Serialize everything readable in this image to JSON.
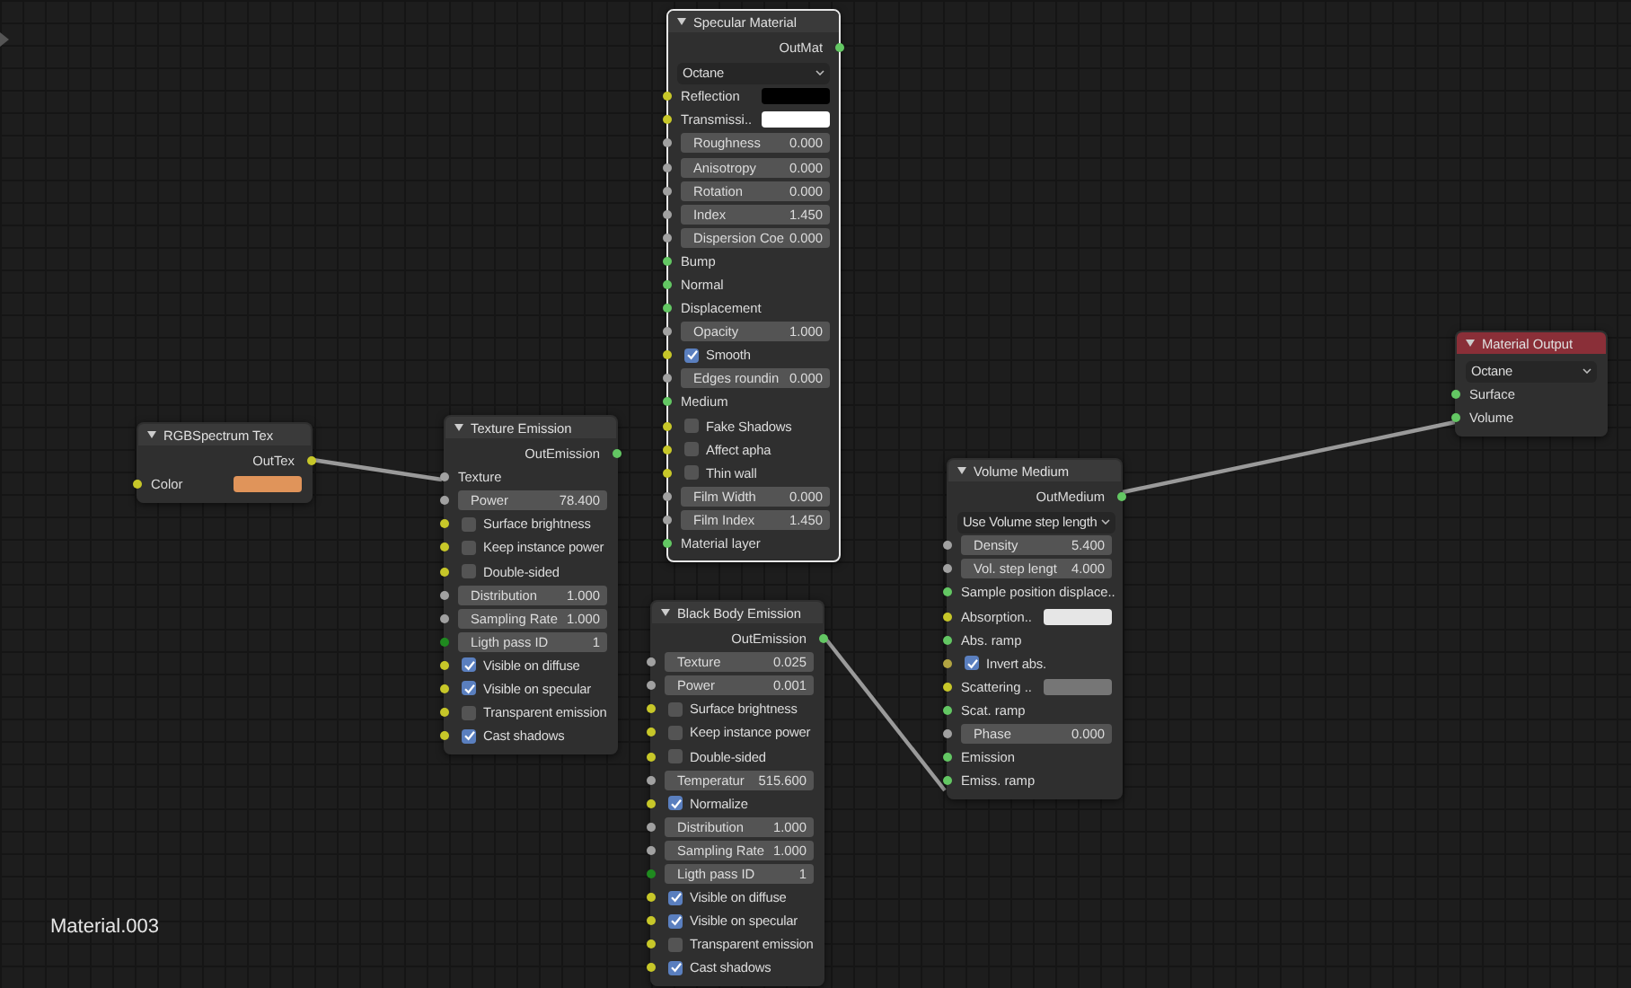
{
  "nodes": [
    {
      "title": "Specular Material",
      "selected": true,
      "color": "#3a3a3a",
      "rows": [
        {
          "kind": "output",
          "label": "OutMat",
          "color": "#63c763"
        },
        {
          "kind": "dropdown",
          "value": "Octane"
        },
        {
          "kind": "color",
          "label": "Reflection",
          "color": "#c7c729",
          "swatch": {
            "color": "#000000"
          }
        },
        {
          "kind": "color",
          "label": "Transmissi..",
          "color": "#c7c729",
          "swatch": {
            "color": "#ffffff"
          }
        },
        {
          "kind": "field",
          "label": "Roughness",
          "value": "0.000",
          "color": "#a1a1a1"
        },
        {
          "kind": "field",
          "label": "Anisotropy",
          "value": "0.000",
          "color": "#a1a1a1"
        },
        {
          "kind": "field",
          "label": "Rotation",
          "value": "0.000",
          "color": "#a1a1a1"
        },
        {
          "kind": "field",
          "label": "Index",
          "value": "1.450",
          "color": "#a1a1a1"
        },
        {
          "kind": "field",
          "label": "Dispersion Coe",
          "value": "0.000",
          "color": "#a1a1a1"
        },
        {
          "kind": "socket",
          "label": "Bump",
          "color": "#63c763"
        },
        {
          "kind": "socket",
          "label": "Normal",
          "color": "#63c763"
        },
        {
          "kind": "socket",
          "label": "Displacement",
          "color": "#63c763"
        },
        {
          "kind": "field",
          "label": "Opacity",
          "value": "1.000",
          "color": "#a1a1a1"
        },
        {
          "kind": "checkbox",
          "label": "Smooth",
          "checked": true,
          "color": "#c7c729"
        },
        {
          "kind": "field",
          "label": "Edges roundin",
          "value": "0.000",
          "color": "#a1a1a1"
        },
        {
          "kind": "socket",
          "label": "Medium",
          "color": "#63c763"
        },
        {
          "kind": "checkbox",
          "label": "Fake Shadows",
          "checked": false,
          "color": "#c7c729"
        },
        {
          "kind": "checkbox",
          "label": "Affect apha",
          "checked": false,
          "color": "#c7c729"
        },
        {
          "kind": "checkbox",
          "label": "Thin wall",
          "checked": false,
          "color": "#c7c729"
        },
        {
          "kind": "field",
          "label": "Film Width",
          "value": "0.000",
          "color": "#a1a1a1"
        },
        {
          "kind": "field",
          "label": "Film Index",
          "value": "1.450",
          "color": "#a1a1a1"
        },
        {
          "kind": "socket",
          "label": "Material layer",
          "color": "#63c763"
        }
      ]
    },
    {
      "title": "RGBSpectrum Tex",
      "selected": false,
      "color": "#3a3a3a",
      "rows": [
        {
          "kind": "output",
          "label": "OutTex",
          "color": "#c7c729"
        },
        {
          "kind": "color",
          "label": "Color",
          "color": "#c7c729",
          "swatch": {
            "color": "#e0945a"
          }
        }
      ]
    },
    {
      "title": "Texture Emission",
      "selected": false,
      "color": "#3a3a3a",
      "rows": [
        {
          "kind": "output",
          "label": "OutEmission",
          "color": "#63c763"
        },
        {
          "kind": "socket",
          "label": "Texture",
          "color": "#a1a1a1"
        },
        {
          "kind": "field",
          "label": "Power",
          "value": "78.400",
          "color": "#a1a1a1"
        },
        {
          "kind": "checkbox",
          "label": "Surface brightness",
          "checked": false,
          "color": "#c7c729"
        },
        {
          "kind": "checkbox",
          "label": "Keep instance power",
          "checked": false,
          "color": "#c7c729"
        },
        {
          "kind": "checkbox",
          "label": "Double-sided",
          "checked": false,
          "color": "#c7c729"
        },
        {
          "kind": "field",
          "label": "Distribution",
          "value": "1.000",
          "color": "#a1a1a1"
        },
        {
          "kind": "field",
          "label": "Sampling Rate",
          "value": "1.000",
          "color": "#a1a1a1"
        },
        {
          "kind": "field",
          "label": "Ligth pass ID",
          "value": "1",
          "color": "#1f8a1f"
        },
        {
          "kind": "checkbox",
          "label": "Visible on diffuse",
          "checked": true,
          "color": "#c7c729"
        },
        {
          "kind": "checkbox",
          "label": "Visible on specular",
          "checked": true,
          "color": "#c7c729"
        },
        {
          "kind": "checkbox",
          "label": "Transparent emission",
          "checked": false,
          "color": "#c7c729"
        },
        {
          "kind": "checkbox",
          "label": "Cast shadows",
          "checked": true,
          "color": "#c7c729"
        }
      ]
    },
    {
      "title": "Black Body Emission",
      "selected": false,
      "color": "#3a3a3a",
      "rows": [
        {
          "kind": "output",
          "label": "OutEmission",
          "color": "#63c763"
        },
        {
          "kind": "field",
          "label": "Texture",
          "value": "0.025",
          "color": "#a1a1a1"
        },
        {
          "kind": "field",
          "label": "Power",
          "value": "0.001",
          "color": "#a1a1a1"
        },
        {
          "kind": "checkbox",
          "label": "Surface brightness",
          "checked": false,
          "color": "#c7c729"
        },
        {
          "kind": "checkbox",
          "label": "Keep instance power",
          "checked": false,
          "color": "#c7c729"
        },
        {
          "kind": "checkbox",
          "label": "Double-sided",
          "checked": false,
          "color": "#c7c729"
        },
        {
          "kind": "field",
          "label": "Temperatur",
          "value": "515.600",
          "color": "#a1a1a1"
        },
        {
          "kind": "checkbox",
          "label": "Normalize",
          "checked": true,
          "color": "#c7c729"
        },
        {
          "kind": "field",
          "label": "Distribution",
          "value": "1.000",
          "color": "#a1a1a1"
        },
        {
          "kind": "field",
          "label": "Sampling Rate",
          "value": "1.000",
          "color": "#a1a1a1"
        },
        {
          "kind": "field",
          "label": "Ligth pass ID",
          "value": "1",
          "color": "#1f8a1f"
        },
        {
          "kind": "checkbox",
          "label": "Visible on diffuse",
          "checked": true,
          "color": "#c7c729"
        },
        {
          "kind": "checkbox",
          "label": "Visible on specular",
          "checked": true,
          "color": "#c7c729"
        },
        {
          "kind": "checkbox",
          "label": "Transparent emission",
          "checked": false,
          "color": "#c7c729"
        },
        {
          "kind": "checkbox",
          "label": "Cast shadows",
          "checked": true,
          "color": "#c7c729"
        }
      ]
    },
    {
      "title": "Volume Medium",
      "selected": false,
      "color": "#3a3a3a",
      "rows": [
        {
          "kind": "output",
          "label": "OutMedium",
          "color": "#63c763"
        },
        {
          "kind": "dropdown",
          "value": "Use Volume step length"
        },
        {
          "kind": "field",
          "label": "Density",
          "value": "5.400",
          "color": "#a1a1a1"
        },
        {
          "kind": "field",
          "label": "Vol. step lengt",
          "value": "4.000",
          "color": "#a1a1a1"
        },
        {
          "kind": "socket",
          "label": "Sample position displace..",
          "color": "#63c763"
        },
        {
          "kind": "color",
          "label": "Absorption..",
          "color": "#c7c729",
          "swatch": {
            "color": "#e6e6e6"
          }
        },
        {
          "kind": "socket",
          "label": "Abs. ramp",
          "color": "#63c763"
        },
        {
          "kind": "checkbox",
          "label": "Invert abs.",
          "checked": true,
          "color": "#b3a542"
        },
        {
          "kind": "color",
          "label": "Scattering ..",
          "color": "#c7c729",
          "swatch": {
            "color": "#767676"
          }
        },
        {
          "kind": "socket",
          "label": "Scat. ramp",
          "color": "#63c763"
        },
        {
          "kind": "field",
          "label": "Phase",
          "value": "0.000",
          "color": "#a1a1a1"
        },
        {
          "kind": "socket",
          "label": "Emission",
          "color": "#63c763"
        },
        {
          "kind": "socket",
          "label": "Emiss. ramp",
          "color": "#63c763"
        }
      ]
    },
    {
      "title": "Material Output",
      "selected": false,
      "color": "#8a2f38",
      "rows": [
        {
          "kind": "dropdown",
          "value": "Octane"
        },
        {
          "kind": "socket",
          "label": "Surface",
          "color": "#63c763"
        },
        {
          "kind": "socket",
          "label": "Volume",
          "color": "#63c763"
        }
      ]
    }
  ],
  "material_name": "Material.003"
}
